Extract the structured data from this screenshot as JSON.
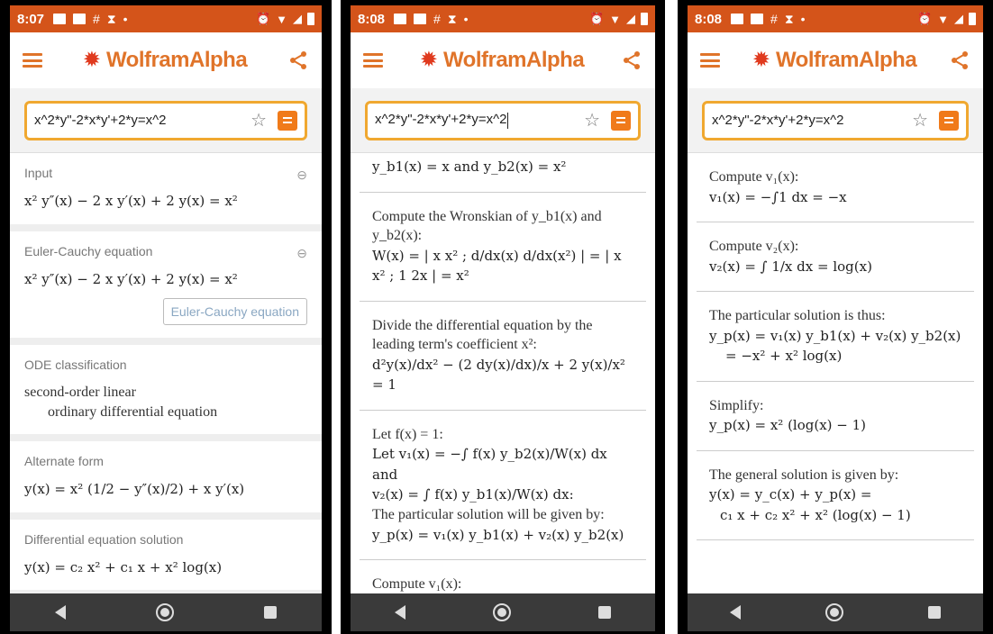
{
  "status": {
    "time1": "8:07",
    "time2": "8:08",
    "time3": "8:08"
  },
  "app": {
    "brand": "WolframAlpha",
    "query": "x^2*y\"-2*x*y'+2*y=x^2"
  },
  "screen1": {
    "pods": [
      {
        "title": "Input",
        "math": "x² y″(x) − 2 x y′(x) + 2 y(x) = x²"
      },
      {
        "title": "Euler-Cauchy equation",
        "math": "x² y″(x) − 2 x y′(x) + 2 y(x) = x²",
        "button": "Euler-Cauchy equation"
      },
      {
        "title": "ODE classification",
        "line1": "second-order linear",
        "line2": "ordinary differential equation"
      },
      {
        "title": "Alternate form",
        "math": "y(x) = x² (1/2 − y″(x)/2) + x y′(x)"
      },
      {
        "title": "Differential equation solution",
        "math": "y(x) = c₂ x² + c₁ x + x² log(x)"
      }
    ]
  },
  "screen2": {
    "basis": "y_b1(x) = x and y_b2(x) = x²",
    "wronskian_text": "Compute the Wronskian of y_b1(x) and y_b2(x):",
    "wronskian_math": "W(x) = | x  x² ; d/dx(x)  d/dx(x²) | = | x  x² ; 1  2x | = x²",
    "divide_text": "Divide the differential equation by the leading term's coefficient x²:",
    "divide_math": "d²y(x)/dx² − (2 dy(x)/dx)/x + 2 y(x)/x² = 1",
    "let_f": "Let f(x) = 1:",
    "let_v1": "Let v₁(x) = −∫ f(x) y_b2(x)/W(x) dx and",
    "let_v2": "v₂(x) = ∫ f(x) y_b1(x)/W(x) dx:",
    "particular_text": "The particular solution will be given by:",
    "particular_math": "y_p(x) = v₁(x) y_b1(x) + v₂(x) y_b2(x)",
    "compute_v1": "Compute v₁(x):"
  },
  "screen3": {
    "v1_text": "Compute v₁(x):",
    "v1_math": "v₁(x) = −∫1 dx = −x",
    "v2_text": "Compute v₂(x):",
    "v2_math": "v₂(x) = ∫ 1/x dx = log(x)",
    "particular_text": "The particular solution is thus:",
    "particular_math1": "y_p(x) = v₁(x) y_b1(x) + v₂(x) y_b2(x)",
    "particular_math2": "= −x² + x² log(x)",
    "simplify_text": "Simplify:",
    "simplify_math": "y_p(x) = x² (log(x) − 1)",
    "general_text": "The general solution is given by:",
    "general_math1": "y(x) = y_c(x) + y_p(x) =",
    "general_math2": "c₁ x + c₂ x² + x² (log(x) − 1)"
  },
  "colors": {
    "statusbar": "#d4541a",
    "brand": "#e0742a",
    "search_border": "#f0a830",
    "navbar": "#3a3a3a"
  },
  "icons": {
    "menu": "hamburger-icon",
    "share": "share-icon",
    "favorite": "star-icon",
    "keyboard": "equals-icon",
    "link": "link-icon",
    "back": "back-icon",
    "home": "home-icon",
    "recent": "recent-apps-icon"
  }
}
